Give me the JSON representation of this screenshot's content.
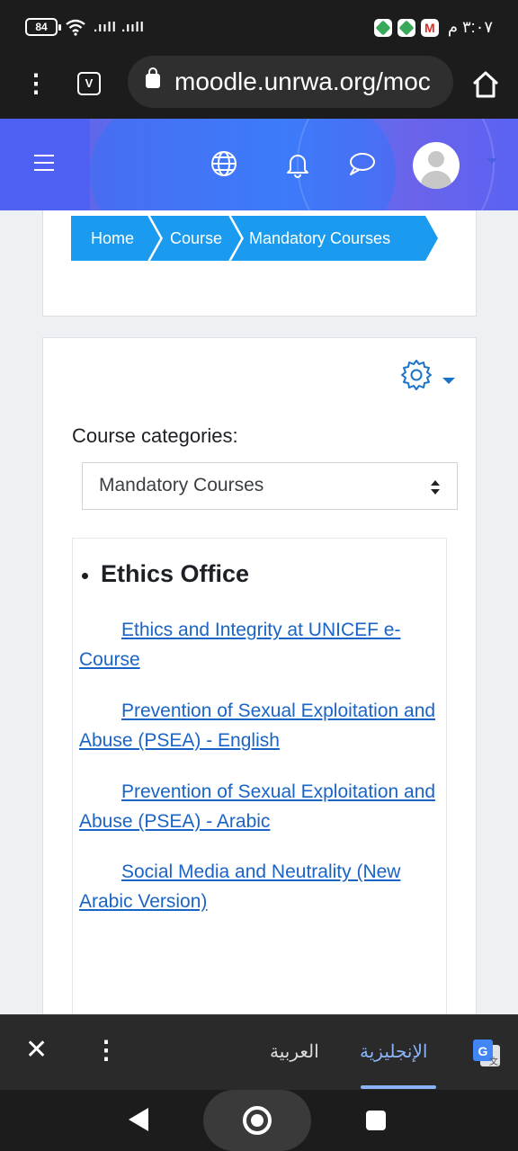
{
  "status_bar": {
    "battery": "84",
    "signal": ".ııll .ııll",
    "time": "٣:٠٧ م",
    "gmail_icon": "M"
  },
  "browser": {
    "url": "moodle.unrwa.org/moc",
    "tab_icon": "V"
  },
  "header": {
    "icons": [
      "menu-icon",
      "globe-icon",
      "bell-icon",
      "chat-icon",
      "user-avatar"
    ]
  },
  "breadcrumb": [
    "Home",
    "Course",
    "Mandatory Courses"
  ],
  "main": {
    "category_label": "Course categories:",
    "category_selected": "Mandatory Courses",
    "section_title": "Ethics Office",
    "courses": [
      "Ethics and Integrity at UNICEF e-Course",
      "Prevention of Sexual Exploitation and Abuse (PSEA) - English",
      "Prevention of Sexual Exploitation and Abuse (PSEA) - Arabic",
      "Social Media and Neutrality (New Arabic Version)"
    ]
  },
  "translate_bar": {
    "close": "✕",
    "more": "⋮",
    "arabic": "العربية",
    "english": "الإنجليزية"
  },
  "colors": {
    "breadcrumb": "#1a9bf0",
    "link": "#1a64c6",
    "header_accent": "#4f61f2"
  }
}
